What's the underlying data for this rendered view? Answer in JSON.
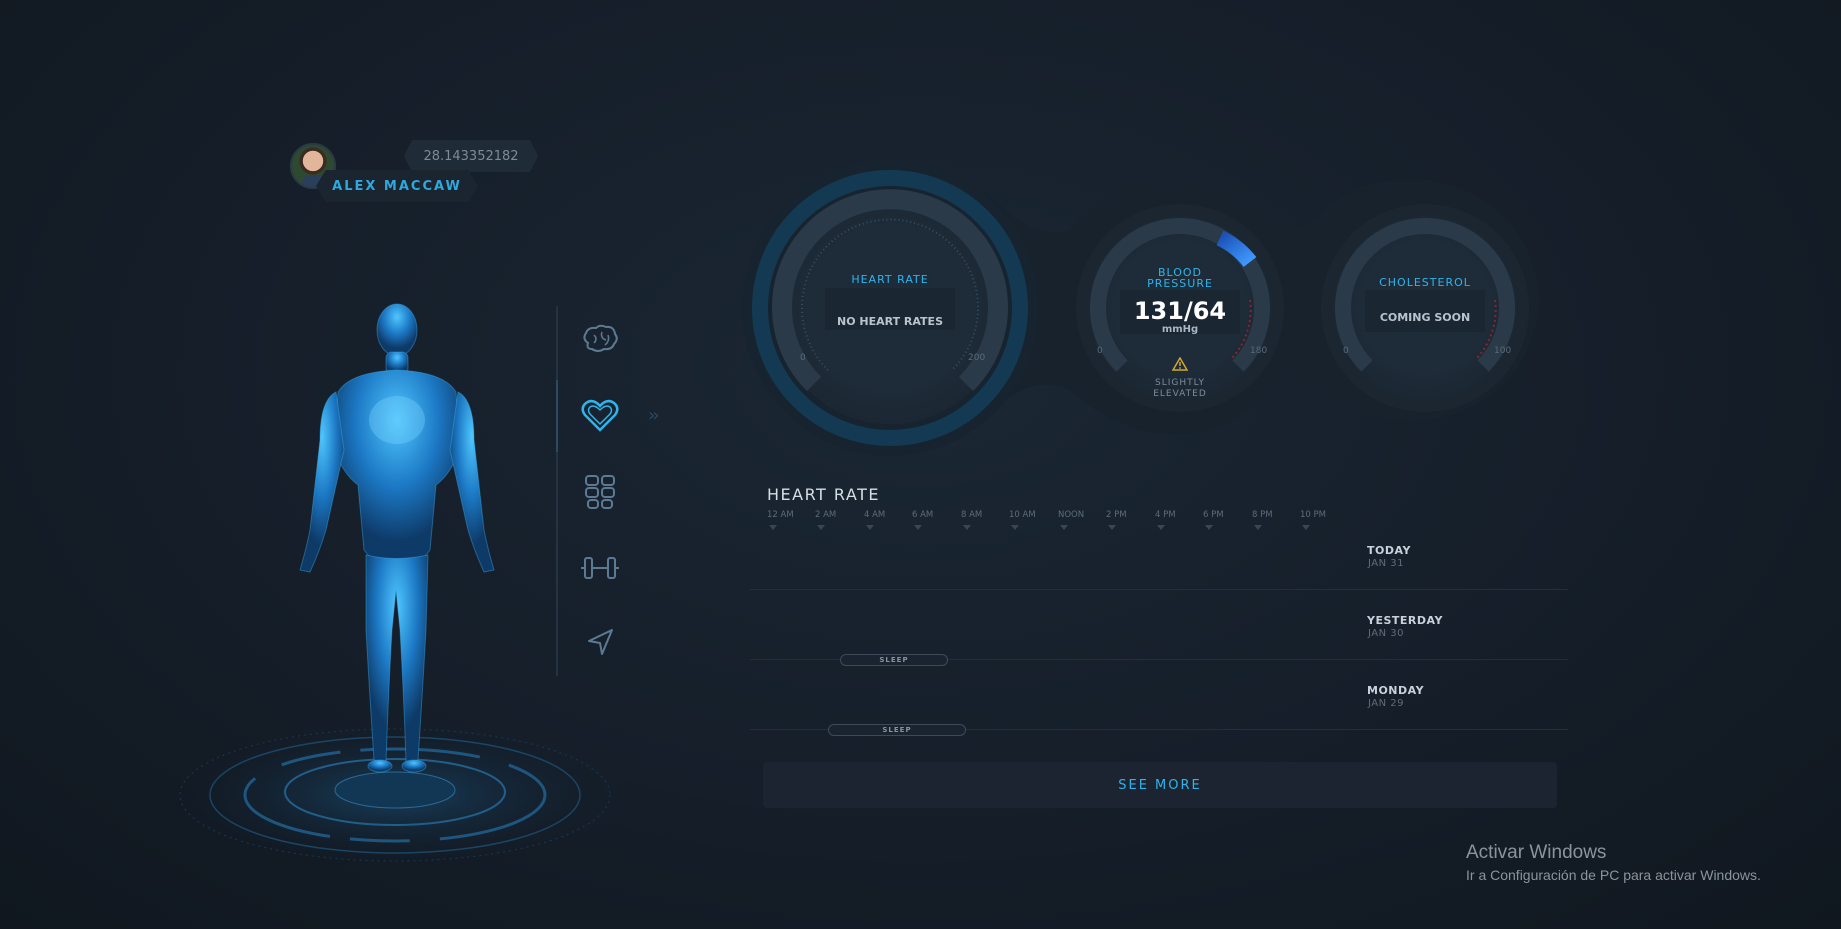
{
  "profile": {
    "name": "ALEX MACCAW",
    "coords": "28.143352182"
  },
  "nav": {
    "items": [
      {
        "icon": "brain-icon"
      },
      {
        "icon": "heart-icon",
        "active": true
      },
      {
        "icon": "grid-icon"
      },
      {
        "icon": "dumbbell-icon"
      },
      {
        "icon": "location-arrow-icon"
      }
    ]
  },
  "gauges": {
    "heart_rate": {
      "label": "HEART RATE",
      "value": "NO HEART RATES",
      "min": "0",
      "max": "200"
    },
    "blood_pressure": {
      "label_line1": "BLOOD",
      "label_line2": "PRESSURE",
      "value": "131/64",
      "unit": "mmHg",
      "min": "0",
      "max": "180",
      "status_line1": "SLIGHTLY",
      "status_line2": "ELEVATED",
      "warning_icon": "warning-icon",
      "accent": "#1f6fe0"
    },
    "cholesterol": {
      "label": "CHOLESTEROL",
      "value": "COMING SOON",
      "min": "0",
      "max": "100"
    }
  },
  "heart_rate_chart": {
    "title": "HEART RATE",
    "times": [
      "12 AM",
      "2 AM",
      "4 AM",
      "6 AM",
      "8 AM",
      "10 AM",
      "NOON",
      "2 PM",
      "4 PM",
      "6 PM",
      "8 PM",
      "10 PM"
    ],
    "days": [
      {
        "title": "TODAY",
        "date": "JAN 31",
        "sleep": null
      },
      {
        "title": "YESTERDAY",
        "date": "JAN 30",
        "sleep": "SLEEP"
      },
      {
        "title": "MONDAY",
        "date": "JAN 29",
        "sleep": "SLEEP"
      }
    ],
    "see_more": "SEE MORE"
  },
  "watermark": {
    "title": "Activar Windows",
    "subtitle": "Ir a Configuración de PC para activar Windows."
  },
  "colors": {
    "accent": "#2fb4ec",
    "background": "#151e29",
    "warning": "#d4a72c"
  }
}
